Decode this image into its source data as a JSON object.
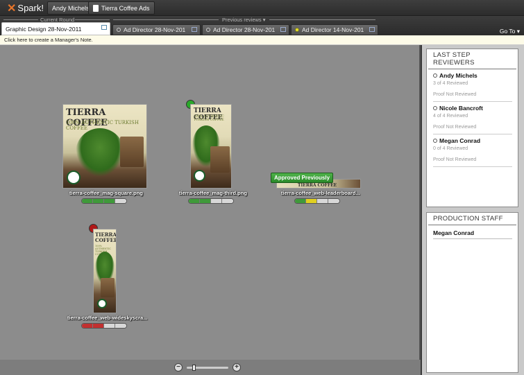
{
  "topbar": {
    "logo": "Spark!",
    "user": "Andy Michels",
    "project": "Tierra Coffee Ads"
  },
  "rounds": {
    "current_label": "Current Round",
    "previous_label": "Previous reviews",
    "tabs": [
      {
        "label": "Graphic Design 28-Nov-2011",
        "active": true
      },
      {
        "label": "Ad Director 28-Nov-201",
        "status": "none"
      },
      {
        "label": "Ad Director 28-Nov-201",
        "status": "none"
      },
      {
        "label": "Ad Director 14-Nov-201",
        "status": "yellow"
      }
    ],
    "goto": "Go To"
  },
  "note": {
    "text": "Click here to create a Manager's Note."
  },
  "assets": [
    {
      "filename": "tierra-coffee_mag-square.png",
      "brand": "TIERRA COFFEE",
      "tagline": "100% AUTHENTIC TURKISH COFFEE",
      "progress": [
        "#3f9a3a",
        "#3f9a3a",
        "#3f9a3a",
        "#d8d8d8"
      ]
    },
    {
      "filename": "tierra-coffee_mag-third.png",
      "brand": "TIERRA COFFEE",
      "tagline": "100% AUTHENTIC TURKISH COFFEE",
      "pin": "#2aa82a",
      "progress": [
        "#3f9a3a",
        "#3f9a3a",
        "#d8d8d8",
        "#d8d8d8"
      ]
    },
    {
      "filename": "tierra-coffee_web-leaderboard...",
      "brand": "TIERRA COFFEE",
      "badge": "Approved Previously",
      "progress": [
        "#3f9a3a",
        "#e0d020",
        "#d8d8d8",
        "#d8d8d8"
      ]
    },
    {
      "filename": "tierra-coffee_web-wideskyscra...",
      "brand": "TIERRA COFFEE",
      "tagline": "100% AUTHENTIC TURKISH COFFEE",
      "pin": "#b01818",
      "progress": [
        "#c23030",
        "#c23030",
        "#d8d8d8",
        "#d8d8d8"
      ]
    }
  ],
  "reviewers_panel": {
    "title": "LAST STEP REVIEWERS",
    "reviewers": [
      {
        "name": "Andy Michels",
        "reviewed": "3 of 4 Reviewed",
        "proof": "Proof Not Reviewed"
      },
      {
        "name": "Nicole Bancroft",
        "reviewed": "4 of 4 Reviewed",
        "proof": "Proof Not Reviewed"
      },
      {
        "name": "Megan Conrad",
        "reviewed": "0 of 4 Reviewed",
        "proof": "Proof Not Reviewed"
      }
    ]
  },
  "staff_panel": {
    "title": "PRODUCTION STAFF",
    "members": [
      "Megan Conrad"
    ]
  },
  "zoom": {
    "minus": "−",
    "plus": "+"
  }
}
